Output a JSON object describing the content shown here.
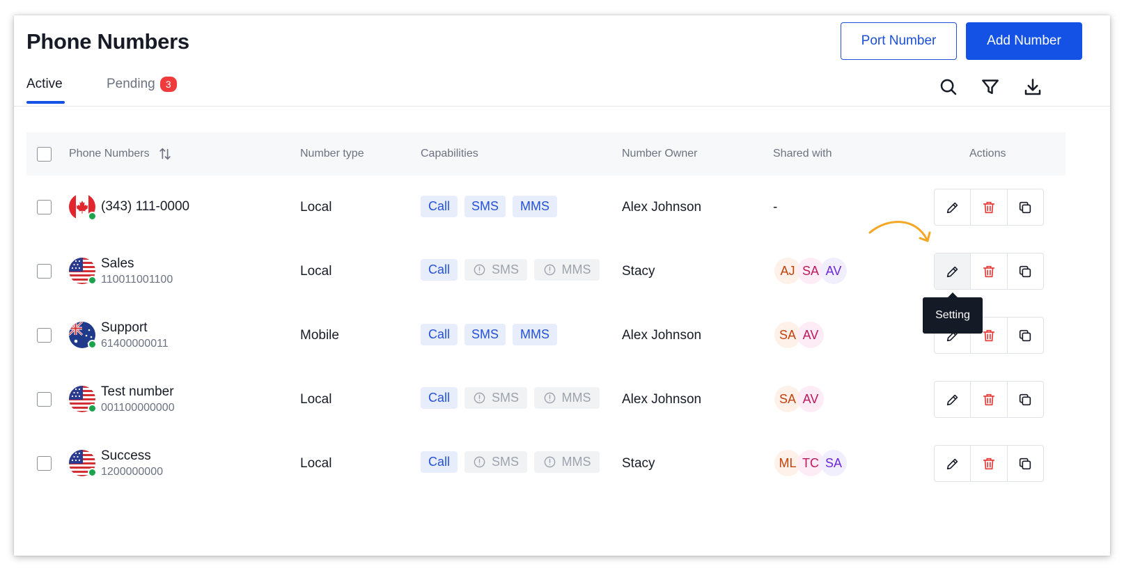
{
  "page": {
    "title": "Phone Numbers",
    "port_button": "Port Number",
    "add_button": "Add Number"
  },
  "tabs": [
    {
      "label": "Active",
      "active": true
    },
    {
      "label": "Pending",
      "count": "3",
      "active": false
    }
  ],
  "toolbar_icons": [
    "search-icon",
    "filter-icon",
    "download-icon"
  ],
  "table": {
    "headers": {
      "phone_numbers": "Phone Numbers",
      "number_type": "Number type",
      "capabilities": "Capabilities",
      "number_owner": "Number Owner",
      "shared_with": "Shared with",
      "actions": "Actions"
    },
    "rows": [
      {
        "flag": "canada",
        "title": "(343) 111-0000",
        "subtitle": "",
        "type": "Local",
        "caps": {
          "call": "Call",
          "sms": "SMS",
          "mms": "MMS"
        },
        "caps_enabled": [
          true,
          true,
          true
        ],
        "owner": "Alex Johnson",
        "shared": "-"
      },
      {
        "flag": "usa",
        "title": "Sales",
        "subtitle": "110011001100",
        "type": "Local",
        "caps": {
          "call": "Call",
          "sms": "SMS",
          "mms": "MMS"
        },
        "caps_enabled": [
          true,
          false,
          false
        ],
        "owner": "Stacy",
        "shared": [
          "AJ",
          "SA",
          "AV"
        ]
      },
      {
        "flag": "australia",
        "title": "Support",
        "subtitle": "61400000011",
        "type": "Mobile",
        "caps": {
          "call": "Call",
          "sms": "SMS",
          "mms": "MMS"
        },
        "caps_enabled": [
          true,
          true,
          true
        ],
        "owner": "Alex Johnson",
        "shared": [
          "SA",
          "AV"
        ]
      },
      {
        "flag": "usa",
        "title": "Test number",
        "subtitle": "001100000000",
        "type": "Local",
        "caps": {
          "call": "Call",
          "sms": "SMS",
          "mms": "MMS"
        },
        "caps_enabled": [
          true,
          false,
          false
        ],
        "owner": "Alex Johnson",
        "shared": [
          "SA",
          "AV"
        ]
      },
      {
        "flag": "usa",
        "title": "Success",
        "subtitle": "1200000000",
        "type": "Local",
        "caps": {
          "call": "Call",
          "sms": "SMS",
          "mms": "MMS"
        },
        "caps_enabled": [
          true,
          false,
          false
        ],
        "owner": "Stacy",
        "shared": [
          "ML",
          "TC",
          "SA"
        ]
      }
    ]
  },
  "row_action_icons": [
    "edit-icon",
    "delete-icon",
    "copy-icon"
  ],
  "tooltip": "Setting",
  "colors": {
    "primary": "#1452e6",
    "danger": "#e53935",
    "online": "#19a34a",
    "tooltip_bg": "#141a26",
    "annotation_arrow": "#f5a623"
  }
}
